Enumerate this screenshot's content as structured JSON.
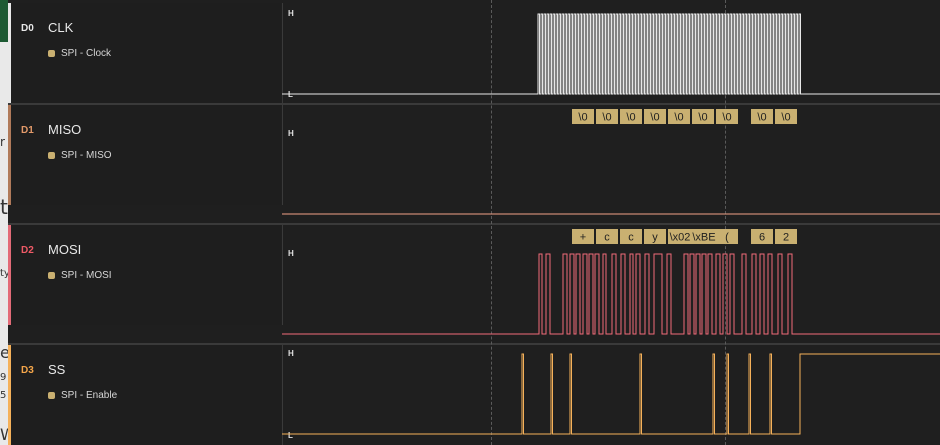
{
  "left_fragments": [
    "r",
    "t",
    "ty",
    "e",
    "9",
    "5",
    "W"
  ],
  "level_high": "H",
  "level_low": "L",
  "channels": [
    {
      "id": "D0",
      "name": "CLK",
      "analyzer": "SPI - Clock",
      "color": "#e8e8e8",
      "id_color": "#e8e8e8",
      "bar_color": "#e9e9e9"
    },
    {
      "id": "D1",
      "name": "MISO",
      "analyzer": "SPI - MISO",
      "color": "#f0a287",
      "id_color": "#e39a6a",
      "bar_color": "#b07a5a"
    },
    {
      "id": "D2",
      "name": "MOSI",
      "analyzer": "SPI - MOSI",
      "color": "#f06b78",
      "id_color": "#ef5a66",
      "bar_color": "#e36b78"
    },
    {
      "id": "D3",
      "name": "SS",
      "analyzer": "SPI - Enable",
      "color": "#f5b15a",
      "id_color": "#f5a64a",
      "bar_color": "#f5b15a"
    }
  ],
  "miso_bytes": [
    "\\0",
    "\\0",
    "\\0",
    "\\0",
    "\\0",
    "\\0",
    "\\0",
    "\\0",
    "\\0"
  ],
  "mosi_bytes": [
    "+",
    "c",
    "c",
    "y",
    "\\x02",
    "\\xBE",
    "(",
    "6",
    "2"
  ],
  "annotation_color": "#c9b071"
}
